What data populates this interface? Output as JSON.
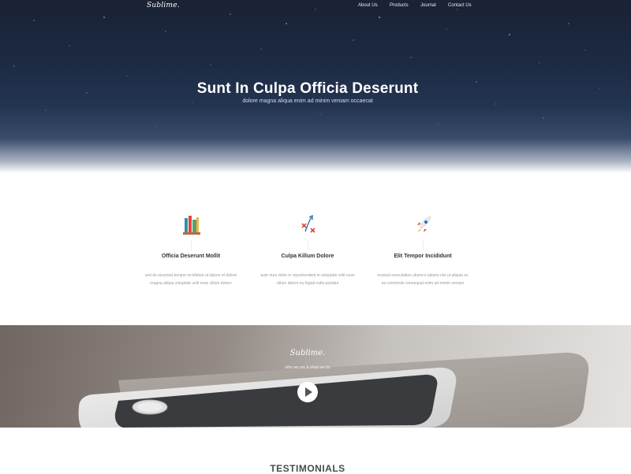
{
  "nav": {
    "logo": "Sublime.",
    "links": [
      "About Us",
      "Products",
      "Journal",
      "Contact Us"
    ]
  },
  "hero": {
    "title": "Sunt In Culpa Officia Deserunt",
    "subtitle": "dolore magna aliqua enim ad minim veniam occaecat"
  },
  "features": [
    {
      "icon": "books-icon",
      "title": "Officia Deserunt Mollit",
      "text": "sed do eiusmod tempor incididunt ut labore et dolore magna aliqua voluptate velit esse cillum dolore"
    },
    {
      "icon": "strategy-icon",
      "title": "Culpa Killum Dolore",
      "text": "aute irure dolor in reprehenderit in voluptate velit esse cillum dolore eu fugiat nulla pariatur"
    },
    {
      "icon": "rocket-icon",
      "title": "Elit Tempor Incididunt",
      "text": "nostrud exercitation ullamco laboris nisi ut aliquip ex ea commodo consequat enim ad minim veniam"
    }
  ],
  "video_band": {
    "logo": "Sublime.",
    "tagline": "who we are & what we do",
    "play_icon": "play-icon"
  },
  "testimonials": {
    "heading": "TESTIMONIALS"
  },
  "colors": {
    "hero_dark": "#1c2a43",
    "rocket_red": "#e1463c",
    "strategy_red": "#d9473f",
    "text_gray": "#9a9a9a"
  }
}
